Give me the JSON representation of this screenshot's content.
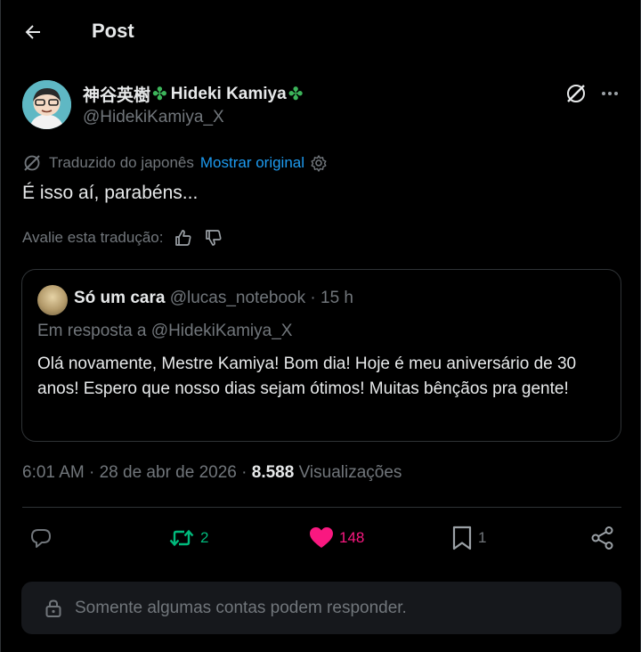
{
  "header": {
    "title": "Post"
  },
  "author": {
    "name": "神谷英樹",
    "name_latin": "Hideki Kamiya",
    "handle": "@HidekiKamiya_X"
  },
  "translation": {
    "note": "Traduzido do japonês",
    "show_original": "Mostrar original",
    "rate_label": "Avalie esta tradução:"
  },
  "post": {
    "text": "É isso aí, parabéns..."
  },
  "quote": {
    "name": "Só um cara",
    "handle": "@lucas_notebook",
    "time": "· 15 h",
    "reply_to": "Em resposta a @HidekiKamiya_X",
    "text": "Olá novamente, Mestre Kamiya! Bom dia! Hoje é meu aniversário de 30 anos! Espero que nosso dias sejam ótimos! Muitas bênçãos pra gente!"
  },
  "meta": {
    "time": "6:01 AM",
    "date": "28 de abr de 2026",
    "views_count": "8.588",
    "views_label": "Visualizações"
  },
  "actions": {
    "retweets": "2",
    "likes": "148",
    "bookmarks": "1"
  },
  "reply_restriction": "Somente algumas contas podem responder.",
  "colors": {
    "background": "#000000",
    "text": "#e7e9ea",
    "muted": "#71767b",
    "link": "#1d9bf0",
    "retweet": "#00ba7c",
    "like": "#f91880",
    "border": "#2f3336",
    "clover": "#3cb45a"
  },
  "icons": {
    "back": "arrow-left-icon",
    "grok": "grok-icon",
    "more": "more-dots-icon",
    "translate": "translate-icon",
    "settings": "gear-icon",
    "thumbs_up": "thumbs-up-icon",
    "thumbs_down": "thumbs-down-icon",
    "reply": "reply-icon",
    "retweet": "retweet-icon",
    "like": "heart-icon",
    "bookmark": "bookmark-icon",
    "share": "share-icon",
    "lock": "lock-icon"
  }
}
